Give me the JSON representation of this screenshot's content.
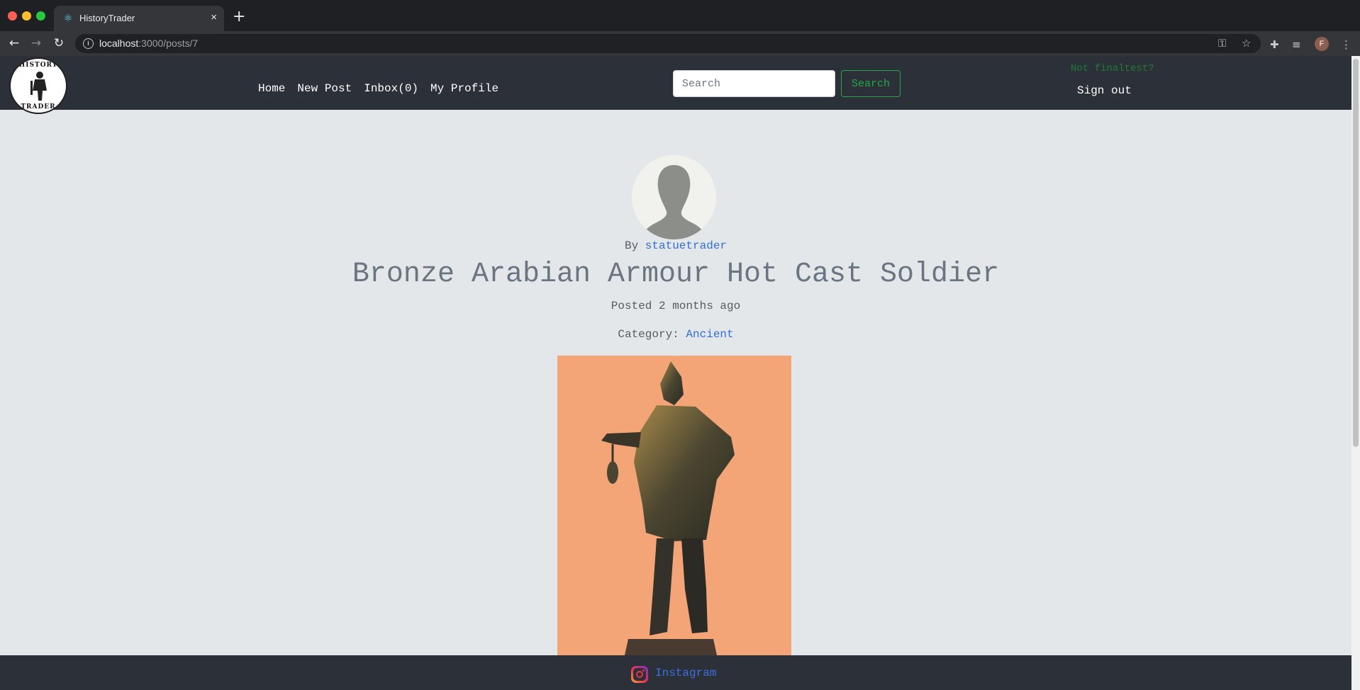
{
  "browser": {
    "tab_title": "HistoryTrader",
    "tab_close": "×",
    "new_tab": "+",
    "url_host": "localhost",
    "url_path": ":3000/posts/7",
    "profile_initial": "F"
  },
  "navbar": {
    "logo_top_text": "HISTORY",
    "logo_bottom_text": "TRADER",
    "links": {
      "home": "Home",
      "new_post": "New Post",
      "inbox": "Inbox(0)",
      "my_profile": "My Profile"
    },
    "search_placeholder": "Search",
    "search_button": "Search",
    "not_user": "Not finaltest?",
    "sign_out": "Sign out"
  },
  "post": {
    "by_prefix": "By",
    "author": "statuetrader",
    "title": "Bronze Arabian Armour Hot Cast Soldier",
    "posted": "Posted 2 months ago",
    "category_label": "Category:",
    "category": "Ancient"
  },
  "footer": {
    "instagram_label": "Instagram"
  },
  "colors": {
    "navbar_bg": "#2c3038",
    "page_bg": "#e4e7ea",
    "link_blue": "#2f6fd6",
    "search_green": "#28a745",
    "image_bg": "#f3a577"
  },
  "icons": [
    "react-icon",
    "back-arrow-icon",
    "forward-arrow-icon",
    "reload-icon",
    "info-icon",
    "key-icon",
    "star-icon",
    "puzzle-icon",
    "media-queue-icon",
    "menu-dots-icon",
    "instagram-icon"
  ]
}
